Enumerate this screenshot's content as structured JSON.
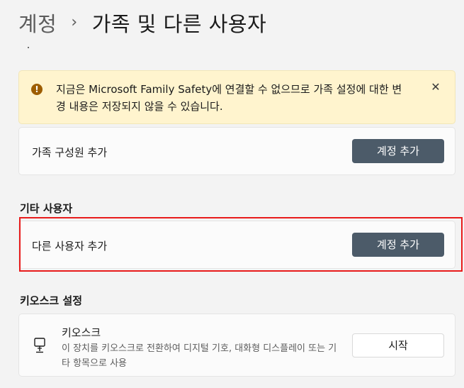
{
  "breadcrumb": {
    "parent": "계정",
    "separator": "›",
    "current": "가족 및 다른 사용자"
  },
  "banner": {
    "icon": "warning-icon",
    "text": "지금은 Microsoft Family Safety에 연결할 수 없으므로 가족 설정에 대한 변경 내용은 저장되지 않을 수 있습니다.",
    "close_glyph": "✕",
    "colors": {
      "background": "#fff4ce",
      "icon": "#9d5d00"
    }
  },
  "family_card": {
    "label": "가족 구성원 추가",
    "button_label": "계정 추가"
  },
  "other_users": {
    "section_title": "기타 사용자",
    "label": "다른 사용자 추가",
    "button_label": "계정 추가",
    "highlight_color": "#e81b1b"
  },
  "kiosk": {
    "section_title": "키오스크 설정",
    "icon": "kiosk-icon",
    "title": "키오스크",
    "description": "이 장치를 키오스크로 전환하여 디지털 기호, 대화형 디스플레이 또는 기타 항목으로 사용",
    "button_label": "시작"
  },
  "colors": {
    "accent_button": "#4c5b69",
    "page_background": "#f3f3f3",
    "card_background": "#fbfbfb"
  }
}
